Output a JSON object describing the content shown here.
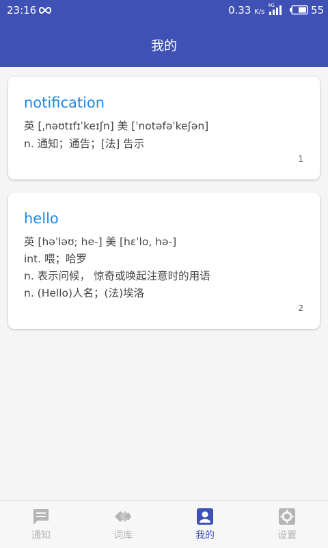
{
  "status_bar": {
    "time": "23:16",
    "speed": "0.33",
    "speed_unit": "K/s",
    "network": "4G",
    "battery": "55"
  },
  "header": {
    "title": "我的"
  },
  "cards": [
    {
      "word": "notification",
      "phonetic": "英 [ˌnəʊtɪfɪˈkeɪʃn]  美 [ˈnotəfəˈkeʃən]",
      "definitions": [
        "n. 通知；通告；[法] 告示"
      ],
      "number": "1"
    },
    {
      "word": "hello",
      "phonetic": "英 [həˈləʊ; he-]  美 [hɛˈlo, hə-]",
      "definitions": [
        "int. 喂；哈罗",
        "n. 表示问候， 惊奇或唤起注意时的用语",
        "n. (Hello)人名；(法)埃洛"
      ],
      "number": "2"
    }
  ],
  "bottom_nav": {
    "items": [
      {
        "label": "通知",
        "icon": "message-icon",
        "active": false
      },
      {
        "label": "词库",
        "icon": "library-icon",
        "active": false
      },
      {
        "label": "我的",
        "icon": "person-icon",
        "active": true
      },
      {
        "label": "设置",
        "icon": "gear-icon",
        "active": false
      }
    ]
  },
  "colors": {
    "primary": "#3f51b5",
    "word": "#1e88e5",
    "inactive": "#b5b5b5"
  }
}
